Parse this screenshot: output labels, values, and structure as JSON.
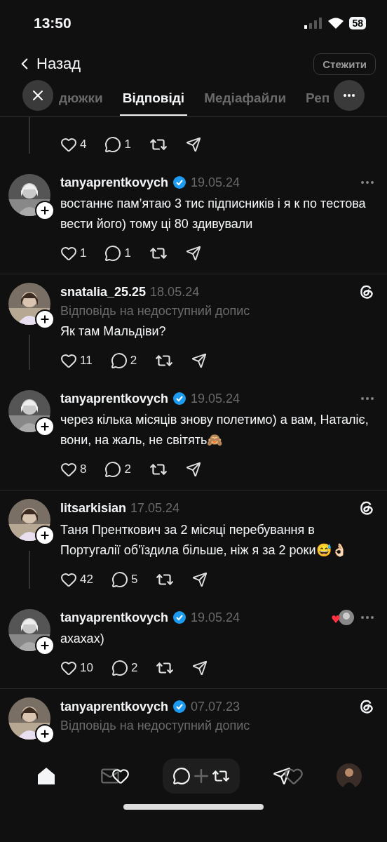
{
  "status_bar": {
    "time": "13:50",
    "battery": "58"
  },
  "header": {
    "back": "Назад",
    "follow": "Стежити"
  },
  "tabs": [
    {
      "label": "дюжки",
      "selected": false
    },
    {
      "label": "Відповіді",
      "selected": true
    },
    {
      "label": "Медіафайли",
      "selected": false
    },
    {
      "label": "Реп",
      "selected": false
    }
  ],
  "top_post": {
    "likes": "4",
    "replies": "1"
  },
  "posts": [
    {
      "kind": "more",
      "username": "tanyaprentkovych",
      "verified": true,
      "date": "19.05.24",
      "text": "востаннє пам’ятаю 3 тис підписників і я к по тестова вести його) тому ці 80 здивували",
      "likes": "1",
      "replies": "1",
      "connected": false,
      "liked_by_author": false,
      "divider": true
    },
    {
      "kind": "threads",
      "username": "snatalia_25.25",
      "verified": false,
      "date": "18.05.24",
      "context": "Відповідь на недоступний допис",
      "text": "Як там Мальдіви?",
      "likes": "11",
      "replies": "2",
      "connected": true,
      "liked_by_author": false,
      "divider": false
    },
    {
      "kind": "more",
      "username": "tanyaprentkovych",
      "verified": true,
      "date": "19.05.24",
      "text": "через кілька місяців знову полетимо) а вам, Наталіє, вони, на жаль, не світять🙈",
      "likes": "8",
      "replies": "2",
      "connected": false,
      "liked_by_author": false,
      "divider": true
    },
    {
      "kind": "threads",
      "username": "litsarkisian",
      "verified": false,
      "date": "17.05.24",
      "text": "Таня Пренткович за 2 місяці перебування в Португалії об’їздила більше, ніж я за 2 роки😅👌🏻",
      "likes": "42",
      "replies": "5",
      "connected": true,
      "liked_by_author": false,
      "divider": false
    },
    {
      "kind": "more",
      "username": "tanyaprentkovych",
      "verified": true,
      "date": "19.05.24",
      "text": "ахахах)",
      "likes": "10",
      "replies": "2",
      "connected": false,
      "liked_by_author": true,
      "divider": true
    },
    {
      "kind": "threads",
      "username": "tanyaprentkovych",
      "verified": true,
      "date": "07.07.23",
      "context": "Відповідь на недоступний допис",
      "connected": false,
      "liked_by_author": false,
      "divider": false
    }
  ]
}
